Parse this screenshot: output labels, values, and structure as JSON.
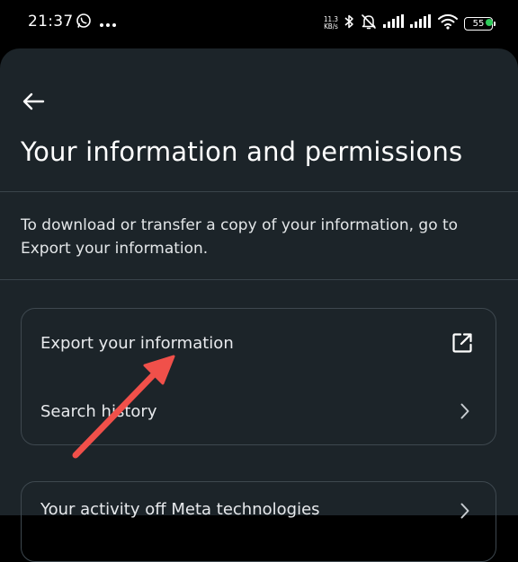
{
  "status_bar": {
    "time": "21:37",
    "net_speed_value": "11.3",
    "net_speed_unit": "KB/s",
    "battery_level": "55"
  },
  "page": {
    "title": "Your information and permissions",
    "description": "To download or transfer a copy of your information, go to Export your information."
  },
  "menu": {
    "export_label": "Export your information",
    "search_history_label": "Search history",
    "third_item_label": "Your activity off Meta technologies"
  },
  "colors": {
    "sheet_background": "#1c2429",
    "annotation_arrow": "#f0504a",
    "battery_dot": "#2ecc5a"
  },
  "icons": {
    "back": "arrow-left-icon",
    "export": "external-link-icon",
    "search_history": "chevron-right-icon"
  }
}
